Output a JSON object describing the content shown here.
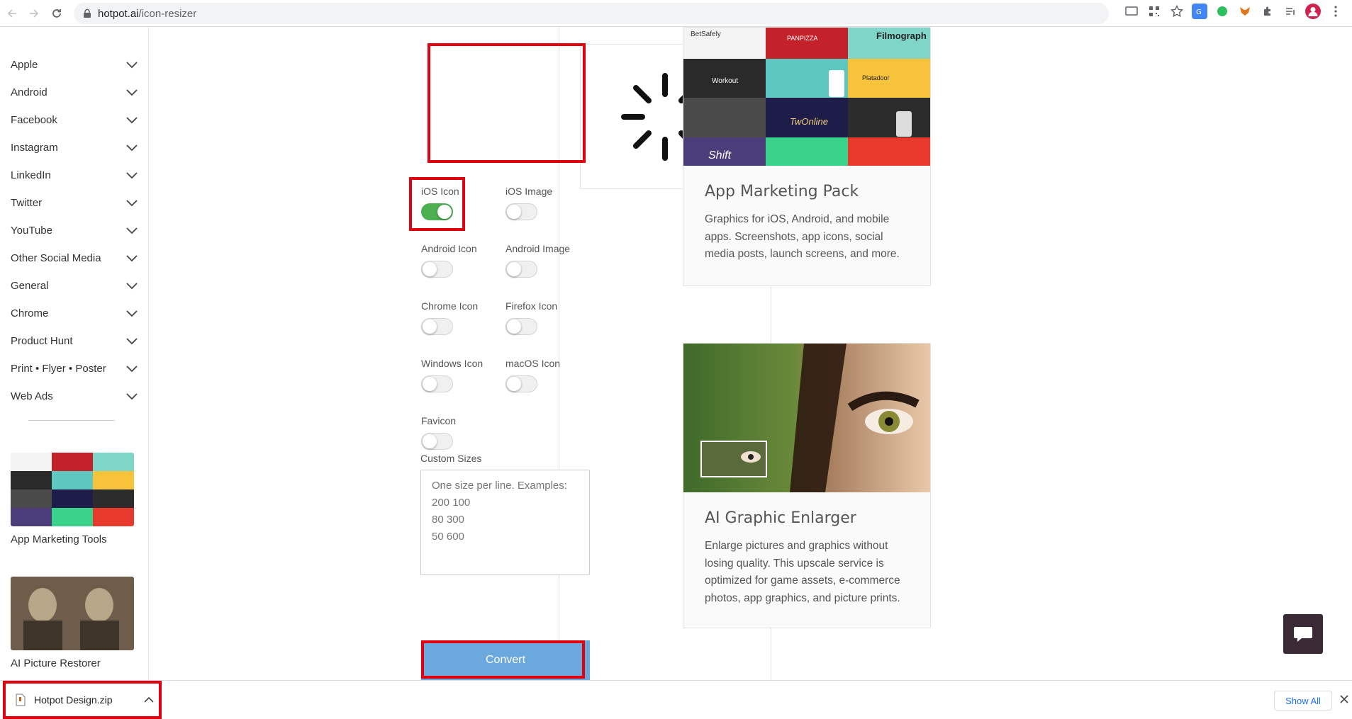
{
  "browser": {
    "url_host": "hotpot.ai",
    "url_path": "/icon-resizer"
  },
  "sidebar": {
    "items": [
      {
        "label": "Apple"
      },
      {
        "label": "Android"
      },
      {
        "label": "Facebook"
      },
      {
        "label": "Instagram"
      },
      {
        "label": "LinkedIn"
      },
      {
        "label": "Twitter"
      },
      {
        "label": "YouTube"
      },
      {
        "label": "Other Social Media"
      },
      {
        "label": "General"
      },
      {
        "label": "Chrome"
      },
      {
        "label": "Product Hunt"
      },
      {
        "label": "Print • Flyer • Poster"
      },
      {
        "label": "Web Ads"
      }
    ],
    "cards": [
      {
        "label": "App Marketing Tools"
      },
      {
        "label": "AI Picture Restorer"
      }
    ]
  },
  "resizer": {
    "toggles": [
      {
        "label": "iOS Icon",
        "on": true
      },
      {
        "label": "iOS Image",
        "on": false
      },
      {
        "label": "Android Icon",
        "on": false
      },
      {
        "label": "Android Image",
        "on": false
      },
      {
        "label": "Chrome Icon",
        "on": false
      },
      {
        "label": "Firefox Icon",
        "on": false
      },
      {
        "label": "Windows Icon",
        "on": false
      },
      {
        "label": "macOS Icon",
        "on": false
      },
      {
        "label": "Favicon",
        "on": false
      }
    ],
    "custom_sizes_label": "Custom Sizes",
    "custom_sizes_placeholder": "One size per line. Examples:\n200 100\n80 300\n50 600",
    "convert_label": "Convert"
  },
  "cards": [
    {
      "title": "App Marketing Pack",
      "description": "Graphics for iOS, Android, and mobile apps. Screenshots, app icons, social media posts, launch screens, and more.",
      "thumb_texts": [
        "BetSafely",
        "PANPIZZA",
        "Filmograph",
        "Workout",
        "Platadoor",
        "TwOnline",
        "Shift"
      ]
    },
    {
      "title": "AI Graphic Enlarger",
      "description": "Enlarge pictures and graphics without losing quality. This upscale service is optimized for game assets, e-commerce photos, app graphics, and picture prints."
    }
  ],
  "downloads": {
    "file_name": "Hotpot Design.zip",
    "show_all_label": "Show All"
  },
  "colors": {
    "toggle_on": "#4caf50",
    "convert_button": "#6aa8de",
    "highlight_red": "#e0000f",
    "chat_button": "#3a2a36"
  }
}
